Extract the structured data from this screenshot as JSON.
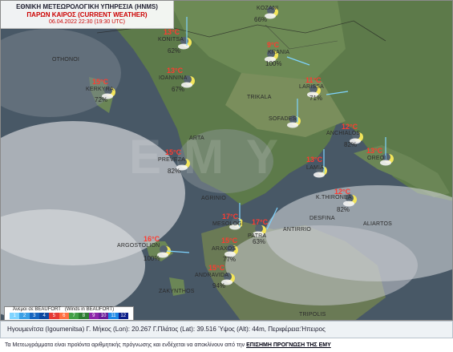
{
  "header": {
    "agency": "ΕΘΝΙΚΗ ΜΕΤΕΩΡΟΛΟΓΙΚΗ ΥΠΗΡΕΣΙΑ (HNMS)",
    "title": "ΠΑΡΩΝ ΚΑΙΡΟΣ (CURRENT WEATHER)",
    "datetime": "06.04.2022 22:30 (19:30 UTC)"
  },
  "watermark": "EMY",
  "stations": [
    {
      "name": "KOZANI",
      "temp": "",
      "humidity": "66%"
    },
    {
      "name": "KONITSA",
      "temp": "13°C",
      "humidity": "62%"
    },
    {
      "name": "KRANIA",
      "temp": "9°C",
      "humidity": "100%"
    },
    {
      "name": "IOANNINA",
      "temp": "13°C",
      "humidity": "67%"
    },
    {
      "name": "KERKYRA",
      "temp": "15°C",
      "humidity": "72%"
    },
    {
      "name": "LARISSA",
      "temp": "11°C",
      "humidity": "71%"
    },
    {
      "name": "TRIKALA",
      "temp": "",
      "humidity": ""
    },
    {
      "name": "SOFADES",
      "temp": "",
      "humidity": ""
    },
    {
      "name": "ANCHIALOS",
      "temp": "12°C",
      "humidity": "82%"
    },
    {
      "name": "ARTA",
      "temp": "",
      "humidity": ""
    },
    {
      "name": "PREVEZA",
      "temp": "15°C",
      "humidity": "82%"
    },
    {
      "name": "LAMIA",
      "temp": "13°C",
      "humidity": ""
    },
    {
      "name": "OREOI",
      "temp": "13°C",
      "humidity": ""
    },
    {
      "name": "K.THIRONEA",
      "temp": "12°C",
      "humidity": "82%"
    },
    {
      "name": "AGRINIO",
      "temp": "",
      "humidity": ""
    },
    {
      "name": "MESOLOGI",
      "temp": "17°C",
      "humidity": ""
    },
    {
      "name": "PATRA",
      "temp": "17°C",
      "humidity": "63%"
    },
    {
      "name": "ANTIRRIO",
      "temp": "",
      "humidity": ""
    },
    {
      "name": "DESFINA",
      "temp": "",
      "humidity": ""
    },
    {
      "name": "ALIARTOS",
      "temp": "",
      "humidity": ""
    },
    {
      "name": "ARGOSTOLION",
      "temp": "16°C",
      "humidity": "100%"
    },
    {
      "name": "ARAXOS",
      "temp": "15°C",
      "humidity": "77%"
    },
    {
      "name": "ANDRAVIDA",
      "temp": "15°C",
      "humidity": "94%"
    },
    {
      "name": "ZAKYNTHOS",
      "temp": "",
      "humidity": ""
    },
    {
      "name": "TRIPOLIS",
      "temp": "",
      "humidity": ""
    },
    {
      "name": "OTHONOI",
      "temp": "",
      "humidity": ""
    }
  ],
  "legend": {
    "title": "Άνεμοι σε BEAUFORT",
    "subtitle": "(Winds in BEAUFORT)",
    "levels": [
      "1",
      "2",
      "3",
      "4",
      "5",
      "6",
      "7",
      "8",
      "9",
      "10",
      "11",
      "12"
    ],
    "colors": [
      "#7fd4ff",
      "#3aa0e6",
      "#1565c0",
      "#0d47a1",
      "#e53935",
      "#ff7043",
      "#43a047",
      "#2e7d32",
      "#8e24aa",
      "#6a1b9a",
      "#1e88e5",
      "#0b1e8a"
    ]
  },
  "info": {
    "location_text": "Ηγουμενίτσα (Igoumenitsa) Γ. Μήκος (Lon): 20.267 Γ.Πλάτος (Lat): 39.516 Ύψος (Alt): 44m, Περιφέρεια:Ήπειρος"
  },
  "disclaimer": {
    "text": "Τα Μετεωγράμματα είναι προϊόντα αριθμητικής πρόγνωσης και ενδέχεται να αποκλίνουν από την ",
    "link": "ΕΠΙΣΗΜΗ ΠΡΟΓΝΩΣΗ ΤΗΣ ΕΜΥ"
  }
}
